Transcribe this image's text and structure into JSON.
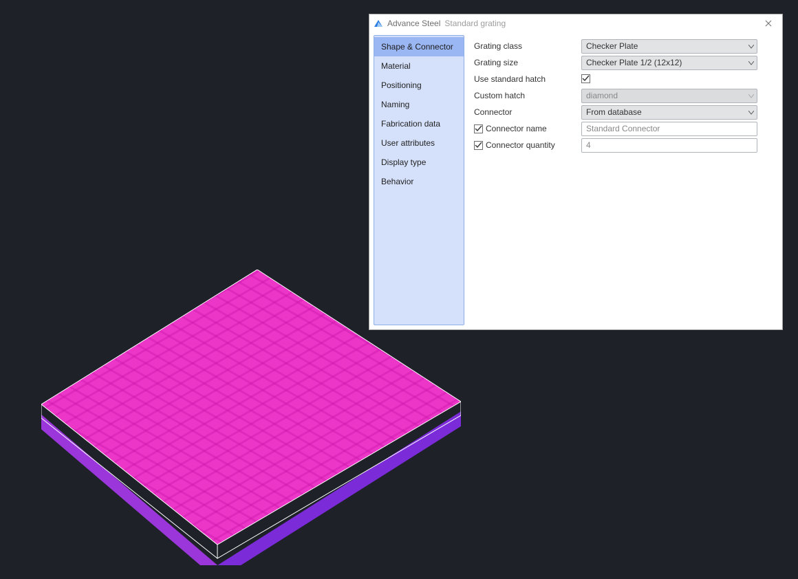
{
  "dialog": {
    "app_name": "Advance Steel",
    "subtitle": "Standard grating"
  },
  "sidebar": {
    "items": [
      {
        "label": "Shape & Connector",
        "selected": true
      },
      {
        "label": "Material"
      },
      {
        "label": "Positioning"
      },
      {
        "label": "Naming"
      },
      {
        "label": "Fabrication data"
      },
      {
        "label": "User attributes"
      },
      {
        "label": "Display type"
      },
      {
        "label": "Behavior"
      }
    ]
  },
  "form": {
    "grating_class": {
      "label": "Grating class",
      "value": "Checker Plate"
    },
    "grating_size": {
      "label": "Grating size",
      "value": "Checker  Plate 1/2 (12x12)"
    },
    "use_std_hatch": {
      "label": "Use standard hatch",
      "checked": true
    },
    "custom_hatch": {
      "label": "Custom hatch",
      "value": "diamond",
      "disabled": true
    },
    "connector": {
      "label": "Connector",
      "value": "From database"
    },
    "connector_name": {
      "label": "Connector name",
      "checked": true,
      "value": "Standard Connector"
    },
    "connector_quantity": {
      "label": "Connector quantity",
      "checked": true,
      "value": "4"
    }
  },
  "colors": {
    "plate_top": "#ec36c7",
    "plate_side_right": "#7b2bd8",
    "plate_side_front": "#9a36da",
    "sidebar_bg": "#d5e1fb",
    "sidebar_selected": "#9bb7f3",
    "canvas_bg": "#1e2228"
  }
}
